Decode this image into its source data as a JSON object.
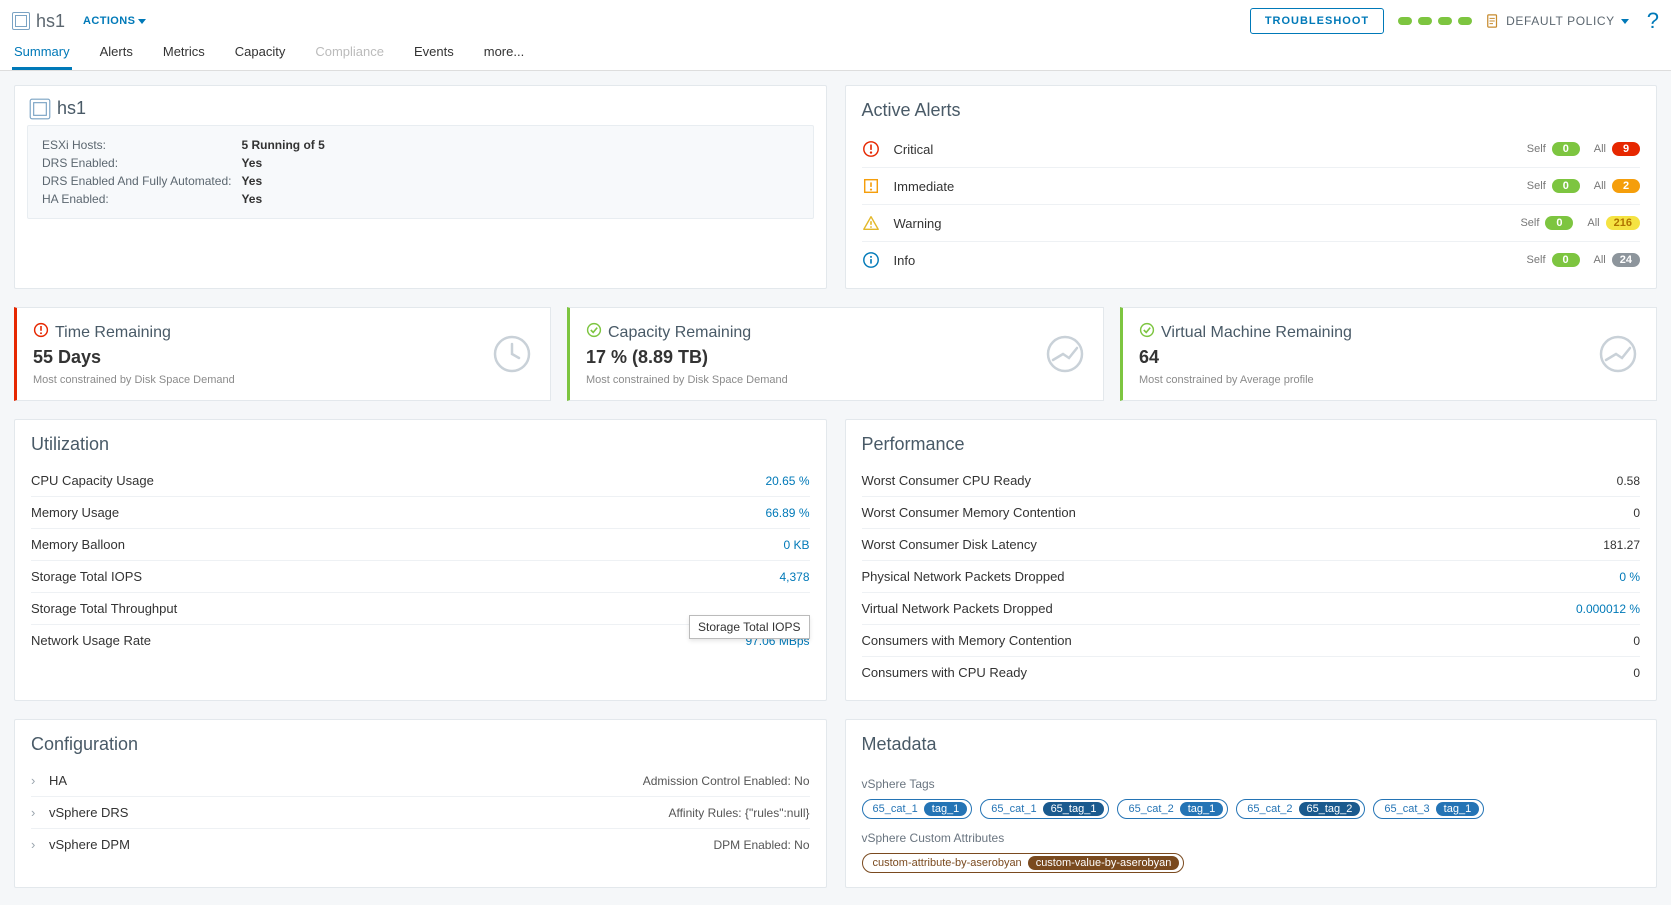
{
  "header": {
    "object_name": "hs1",
    "actions_label": "ACTIONS",
    "troubleshoot_label": "TROUBLESHOOT",
    "dot_colors": [
      "#7dc540",
      "#7dc540",
      "#7dc540",
      "#7dc540"
    ],
    "policy_label": "DEFAULT POLICY"
  },
  "tabs": [
    {
      "label": "Summary",
      "state": "active"
    },
    {
      "label": "Alerts",
      "state": ""
    },
    {
      "label": "Metrics",
      "state": ""
    },
    {
      "label": "Capacity",
      "state": ""
    },
    {
      "label": "Compliance",
      "state": "disabled"
    },
    {
      "label": "Events",
      "state": ""
    },
    {
      "label": "more...",
      "state": "more"
    }
  ],
  "summary": {
    "name": "hs1",
    "rows": [
      {
        "k": "ESXi Hosts:",
        "v": "5 Running of 5"
      },
      {
        "k": "DRS Enabled:",
        "v": "Yes"
      },
      {
        "k": "DRS Enabled And Fully Automated:",
        "v": "Yes"
      },
      {
        "k": "HA Enabled:",
        "v": "Yes"
      }
    ]
  },
  "alerts": {
    "title": "Active Alerts",
    "self_label": "Self",
    "all_label": "All",
    "rows": [
      {
        "sev": "Critical",
        "icon": "critical",
        "self": "0",
        "all": "9",
        "all_cls": "red"
      },
      {
        "sev": "Immediate",
        "icon": "immediate",
        "self": "0",
        "all": "2",
        "all_cls": "orange"
      },
      {
        "sev": "Warning",
        "icon": "warning",
        "self": "0",
        "all": "216",
        "all_cls": "yellow"
      },
      {
        "sev": "Info",
        "icon": "info",
        "self": "0",
        "all": "24",
        "all_cls": "grey"
      }
    ]
  },
  "capacity": [
    {
      "title": "Time Remaining",
      "value": "55 Days",
      "sub": "Most constrained by Disk Space Demand",
      "border": "#e62700",
      "status_icon": "alert",
      "status_color": "#e62700",
      "shape": "clock"
    },
    {
      "title": "Capacity Remaining",
      "value": "17 % (8.89 TB)",
      "sub": "Most constrained by Disk Space Demand",
      "border": "#7dc540",
      "status_icon": "ok",
      "status_color": "#7dc540",
      "shape": "gauge"
    },
    {
      "title": "Virtual Machine Remaining",
      "value": "64",
      "sub": "Most constrained by Average profile",
      "border": "#7dc540",
      "status_icon": "ok",
      "status_color": "#7dc540",
      "shape": "gauge"
    }
  ],
  "utilization": {
    "title": "Utilization",
    "tooltip": "Storage Total IOPS",
    "rows": [
      {
        "lbl": "CPU Capacity Usage",
        "val": "20.65 %",
        "link": true
      },
      {
        "lbl": "Memory Usage",
        "val": "66.89 %",
        "link": true
      },
      {
        "lbl": "Memory Balloon",
        "val": "0 KB",
        "link": true
      },
      {
        "lbl": "Storage Total IOPS",
        "val": "4,378",
        "link": true
      },
      {
        "lbl": "Storage Total Throughput",
        "val": "",
        "link": false,
        "tooltip": true
      },
      {
        "lbl": "Network Usage Rate",
        "val": "97.06 MBps",
        "link": true
      }
    ]
  },
  "performance": {
    "title": "Performance",
    "rows": [
      {
        "lbl": "Worst Consumer CPU Ready",
        "val": "0.58",
        "link": false
      },
      {
        "lbl": "Worst Consumer Memory Contention",
        "val": "0",
        "link": false
      },
      {
        "lbl": "Worst Consumer Disk Latency",
        "val": "181.27",
        "link": false
      },
      {
        "lbl": "Physical Network Packets Dropped",
        "val": "0 %",
        "link": true
      },
      {
        "lbl": "Virtual Network Packets Dropped",
        "val": "0.000012 %",
        "link": true
      },
      {
        "lbl": "Consumers with Memory Contention",
        "val": "0",
        "link": false
      },
      {
        "lbl": "Consumers with CPU Ready",
        "val": "0",
        "link": false
      }
    ]
  },
  "configuration": {
    "title": "Configuration",
    "rows": [
      {
        "lbl": "HA",
        "extra": "Admission Control Enabled: No"
      },
      {
        "lbl": "vSphere DRS",
        "extra": "Affinity Rules: {\"rules\":null}"
      },
      {
        "lbl": "vSphere DPM",
        "extra": "DPM Enabled: No"
      }
    ]
  },
  "metadata": {
    "title": "Metadata",
    "tags_label": "vSphere Tags",
    "tags": [
      {
        "cat": "65_cat_1",
        "tag": "tag_1",
        "dk": false
      },
      {
        "cat": "65_cat_1",
        "tag": "65_tag_1",
        "dk": true
      },
      {
        "cat": "65_cat_2",
        "tag": "tag_1",
        "dk": false
      },
      {
        "cat": "65_cat_2",
        "tag": "65_tag_2",
        "dk": true
      },
      {
        "cat": "65_cat_3",
        "tag": "tag_1",
        "dk": false
      }
    ],
    "attrs_label": "vSphere Custom Attributes",
    "attrs": [
      {
        "k": "custom-attribute-by-aserobyan",
        "v": "custom-value-by-aserobyan"
      }
    ]
  }
}
